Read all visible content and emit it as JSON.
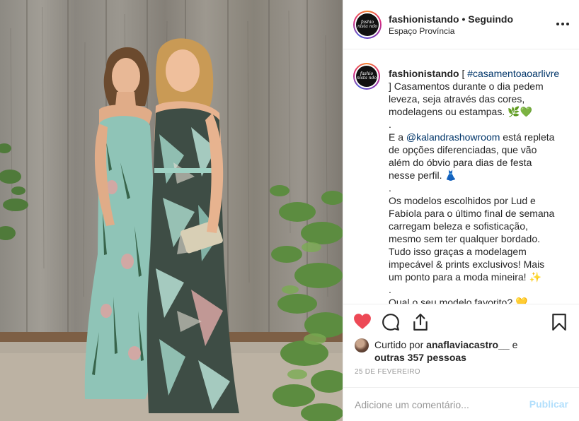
{
  "photo": {
    "alt_subject": "two-women-in-floral-dresses"
  },
  "header": {
    "username": "fashionistando",
    "separator": " • ",
    "follow_status": "Seguindo",
    "location": "Espaço Província",
    "more_icon": "more-horizontal-icon",
    "avatar_text": "fashio nista ndo"
  },
  "caption": {
    "username": "fashionistando",
    "bracket_open": " [ ",
    "hashtag": "#casamentoaoarlivre",
    "lines": [
      "] Casamentos durante o dia pedem",
      "leveza, seja através das cores,",
      "modelagens ou estampas. 🌿💚",
      ".",
      "E a ",
      "@kalandrashowroom",
      " está repleta",
      "de opções diferenciadas, que vão",
      "além do óbvio para dias de festa",
      "nesse perfil. 👗",
      ".",
      "Os modelos escolhidos por Lud e",
      "Fabíola para o último final de semana",
      "carregam beleza e sofisticação,",
      "mesmo sem ter qualquer bordado.",
      "Tudo isso graças a modelagem",
      "impecável & prints exclusivos! Mais",
      "um ponto para a moda mineira! ✨",
      ".",
      "Qual o seu modelo favorito? 💛"
    ]
  },
  "actions": {
    "like_icon": "heart-filled-icon",
    "comment_icon": "comment-icon",
    "share_icon": "share-icon",
    "save_icon": "bookmark-icon",
    "like_color": "#ed4956"
  },
  "likes": {
    "prefix": "Curtido por ",
    "user": "anaflaviacastro__",
    "connector": " e",
    "others": "outras 357 pessoas"
  },
  "date": "25 DE FEVEREIRO",
  "comment": {
    "placeholder": "Adicione um comentário...",
    "publish_label": "Publicar"
  }
}
